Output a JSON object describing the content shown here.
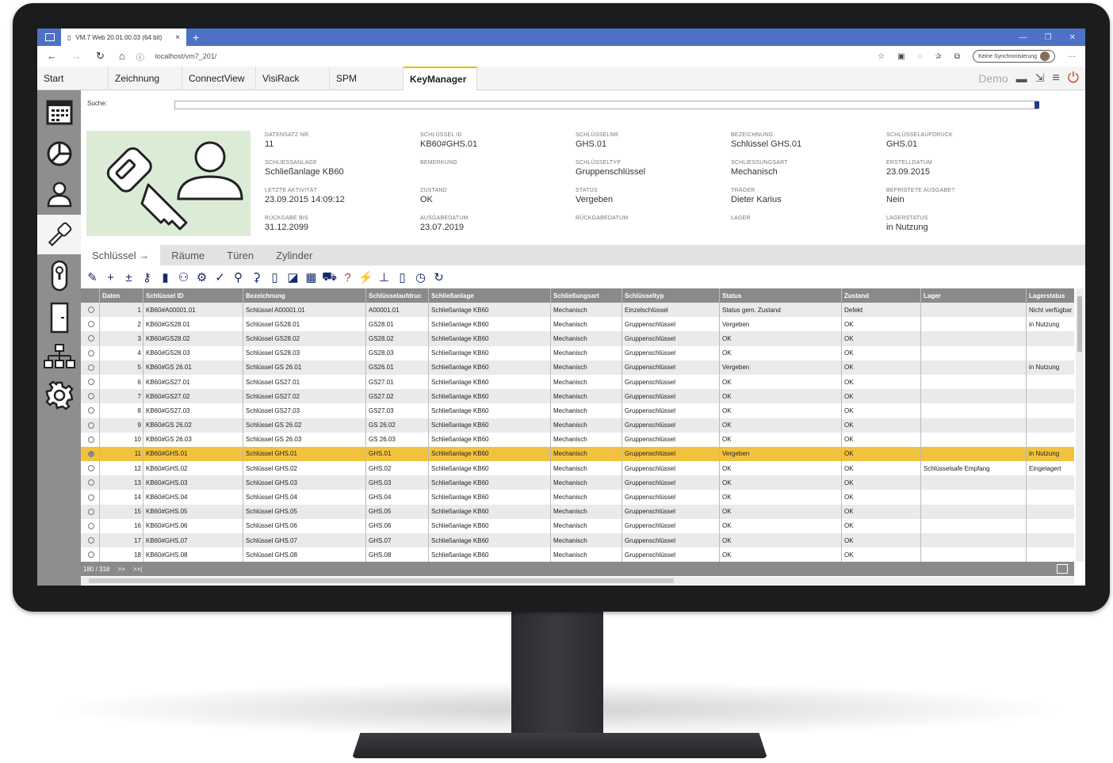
{
  "browser": {
    "tab_title": "VM.7 Web 20.01.00.03 (64 bit)",
    "url": "localhost/vm7_201/",
    "sync_label": "Keine Synchronisierung"
  },
  "app_tabs": [
    "Start",
    "Zeichnung",
    "ConnectView",
    "VisiRack",
    "SPM",
    "KeyManager"
  ],
  "header_right": {
    "demo_label": "Demo"
  },
  "search": {
    "label": "Suche:"
  },
  "details": [
    {
      "label": "DATENSATZ NR.",
      "value": "11"
    },
    {
      "label": "SCHLÜSSEL ID",
      "value": "KB60#GHS.01"
    },
    {
      "label": "SCHLÜSSELNR.",
      "value": "GHS.01"
    },
    {
      "label": "BEZEICHNUNG",
      "value": "Schlüssel GHS.01"
    },
    {
      "label": "SCHLÜSSELAUFDRUCK",
      "value": "GHS.01"
    },
    {
      "label": "SCHLIESSANLAGE",
      "value": "Schließanlage KB60"
    },
    {
      "label": "BEMERKUNG",
      "value": ""
    },
    {
      "label": "SCHLÜSSELTYP",
      "value": "Gruppenschlüssel"
    },
    {
      "label": "SCHLIESSUNGSART",
      "value": "Mechanisch"
    },
    {
      "label": "ERSTELLDATUM",
      "value": "23.09.2015"
    },
    {
      "label": "LETZTE AKTIVITÄT",
      "value": "23.09.2015 14:09:12"
    },
    {
      "label": "ZUSTAND",
      "value": "OK"
    },
    {
      "label": "STATUS",
      "value": "Vergeben"
    },
    {
      "label": "TRÄGER",
      "value": "Dieter Karius"
    },
    {
      "label": "BEFRISTETE AUSGABE?",
      "value": "Nein"
    },
    {
      "label": "RÜCKGABE BIS",
      "value": "31.12.2099"
    },
    {
      "label": "AUSGABEDATUM",
      "value": "23.07.2019"
    },
    {
      "label": "RÜCKGABEDATUM",
      "value": ""
    },
    {
      "label": "LAGER",
      "value": ""
    },
    {
      "label": "LAGERSTATUS",
      "value": "in Nutzung"
    }
  ],
  "sub_tabs": [
    "Schlüssel →",
    "Räume",
    "Türen",
    "Zylinder"
  ],
  "table": {
    "columns": [
      "",
      "Daten",
      "Schlüssel ID",
      "Bezeichnung",
      "Schlüsselaufdruc",
      "Schließanlage",
      "Schließungsart",
      "Schlüsseltyp",
      "Status",
      "Zustand",
      "Lager",
      "Lagerstatus"
    ],
    "rows": [
      [
        "1",
        "KB60#A00001.01",
        "Schlüssel A00001.01",
        "A00001.01",
        "Schließanlage KB60",
        "Mechanisch",
        "Einzelschlüssel",
        "Status gem. Zustand",
        "Defekt",
        "",
        "Nicht verfügbar"
      ],
      [
        "2",
        "KB60#GS28.01",
        "Schlüssel GS28.01",
        "GS28.01",
        "Schließanlage KB60",
        "Mechanisch",
        "Gruppenschlüssel",
        "Vergeben",
        "OK",
        "",
        "in Nutzung"
      ],
      [
        "3",
        "KB60#GS28.02",
        "Schlüssel GS28.02",
        "GS28.02",
        "Schließanlage KB60",
        "Mechanisch",
        "Gruppenschlüssel",
        "OK",
        "OK",
        "",
        ""
      ],
      [
        "4",
        "KB60#GS28.03",
        "Schlüssel GS28.03",
        "GS28.03",
        "Schließanlage KB60",
        "Mechanisch",
        "Gruppenschlüssel",
        "OK",
        "OK",
        "",
        ""
      ],
      [
        "5",
        "KB60#GS 26.01",
        "Schlüssel GS 26.01",
        "GS26.01",
        "Schließanlage KB60",
        "Mechanisch",
        "Gruppenschlüssel",
        "Vergeben",
        "OK",
        "",
        "in Nutzung"
      ],
      [
        "6",
        "KB60#GS27.01",
        "Schlüssel GS27.01",
        "GS27.01",
        "Schließanlage KB60",
        "Mechanisch",
        "Gruppenschlüssel",
        "OK",
        "OK",
        "",
        ""
      ],
      [
        "7",
        "KB60#GS27.02",
        "Schlüssel GS27.02",
        "GS27.02",
        "Schließanlage KB60",
        "Mechanisch",
        "Gruppenschlüssel",
        "OK",
        "OK",
        "",
        ""
      ],
      [
        "8",
        "KB60#GS27.03",
        "Schlüssel GS27.03",
        "GS27.03",
        "Schließanlage KB60",
        "Mechanisch",
        "Gruppenschlüssel",
        "OK",
        "OK",
        "",
        ""
      ],
      [
        "9",
        "KB60#GS 26.02",
        "Schlüssel GS 26.02",
        "GS 26.02",
        "Schließanlage KB60",
        "Mechanisch",
        "Gruppenschlüssel",
        "OK",
        "OK",
        "",
        ""
      ],
      [
        "10",
        "KB60#GS 26.03",
        "Schlüssel GS 26.03",
        "GS 26.03",
        "Schließanlage KB60",
        "Mechanisch",
        "Gruppenschlüssel",
        "OK",
        "OK",
        "",
        ""
      ],
      [
        "11",
        "KB60#GHS.01",
        "Schlüssel GHS.01",
        "GHS.01",
        "Schließanlage KB60",
        "Mechanisch",
        "Gruppenschlüssel",
        "Vergeben",
        "OK",
        "",
        "in Nutzung"
      ],
      [
        "12",
        "KB60#GHS.02",
        "Schlüssel GHS.02",
        "GHS.02",
        "Schließanlage KB60",
        "Mechanisch",
        "Gruppenschlüssel",
        "OK",
        "OK",
        "Schlüsselsafe Empfang",
        "Eingelagert"
      ],
      [
        "13",
        "KB60#GHS.03",
        "Schlüssel GHS.03",
        "GHS.03",
        "Schließanlage KB60",
        "Mechanisch",
        "Gruppenschlüssel",
        "OK",
        "OK",
        "",
        ""
      ],
      [
        "14",
        "KB60#GHS.04",
        "Schlüssel GHS.04",
        "GHS.04",
        "Schließanlage KB60",
        "Mechanisch",
        "Gruppenschlüssel",
        "OK",
        "OK",
        "",
        ""
      ],
      [
        "15",
        "KB60#GHS.05",
        "Schlüssel GHS.05",
        "GHS.05",
        "Schließanlage KB60",
        "Mechanisch",
        "Gruppenschlüssel",
        "OK",
        "OK",
        "",
        ""
      ],
      [
        "16",
        "KB60#GHS.06",
        "Schlüssel GHS.06",
        "GHS.06",
        "Schließanlage KB60",
        "Mechanisch",
        "Gruppenschlüssel",
        "OK",
        "OK",
        "",
        ""
      ],
      [
        "17",
        "KB60#GHS.07",
        "Schlüssel GHS.07",
        "GHS.07",
        "Schließanlage KB60",
        "Mechanisch",
        "Gruppenschlüssel",
        "OK",
        "OK",
        "",
        ""
      ],
      [
        "18",
        "KB60#GHS.08",
        "Schlüssel GHS.08",
        "GHS.08",
        "Schließanlage KB60",
        "Mechanisch",
        "Gruppenschlüssel",
        "OK",
        "OK",
        "",
        ""
      ]
    ],
    "selected_row": 10
  },
  "pager": {
    "count": "180 / 318",
    "next": ">>",
    "last": ">>|"
  },
  "colors": {
    "accent": "#f2c23f",
    "browser_bar": "#4d72c5",
    "toolbar_icons": "#16296a",
    "power": "#d93a2b"
  }
}
